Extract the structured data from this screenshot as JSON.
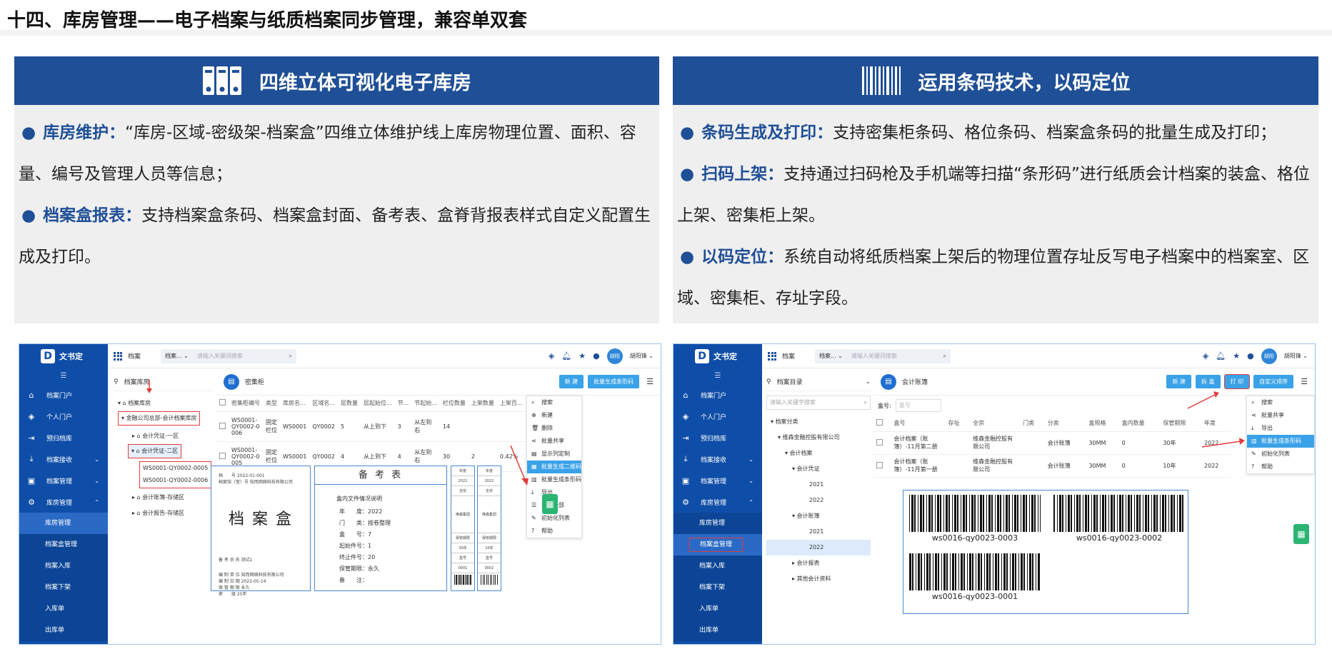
{
  "page": {
    "title": "十四、库房管理——电子档案与纸质档案同步管理，兼容单双套"
  },
  "left_panel": {
    "header": "四维立体可视化电子库房",
    "header_icon": "binders-icon",
    "items": [
      {
        "keyword": "库房维护：",
        "text": "“库房-区域-密级架-档案盒”四维立体维护线上库房物理位置、面积、容量、编号及管理人员等信息；"
      },
      {
        "keyword": "档案盒报表：",
        "text": "支持档案盒条码、档案盒封面、备考表、盒脊背报表样式自定义配置生成及打印。"
      }
    ]
  },
  "right_panel": {
    "header": "运用条码技术，以码定位",
    "header_icon": "barcode-icon",
    "items": [
      {
        "keyword": "条码生成及打印：",
        "text": "支持密集柜条码、格位条码、档案盒条码的批量生成及打印；"
      },
      {
        "keyword": "扫码上架：",
        "text": "支持通过扫码枪及手机端等扫描“条形码”进行纸质会计档案的装盒、格位上架、密集柜上架。"
      },
      {
        "keyword": "以码定位：",
        "text": "系统自动将纸质档案上架后的物理位置存址反写电子档案中的档案室、区域、密集柜、存址字段。"
      }
    ]
  },
  "app": {
    "logo": "文书定",
    "logo_mark": "D",
    "collapse": "☰",
    "top_title": "档案",
    "search_select": "档案... ⌄",
    "search_placeholder": "请输入关键词搜索",
    "avatar": "胡阳",
    "username": "胡阳锋 ⌄",
    "nav": [
      "档案门户",
      "个人门户",
      "预归档库",
      "档案接收",
      "档案管理",
      "库房管理"
    ],
    "nav_sub": [
      "库房管理",
      "档案盒管理",
      "档案入库",
      "档案下架",
      "入库单",
      "出库单"
    ]
  },
  "left_shot": {
    "tree_title": "档案库房",
    "tree": [
      "档案库房",
      "金融公司总部-会计档案库房",
      "会计凭证-一区",
      "会计凭证-二区",
      "WS0001-QY0002-0005",
      "WS0001-QY0002-0006",
      "会计账簿-存储区",
      "会计报告-存储区"
    ],
    "content_title": "密集柜",
    "buttons": [
      "新 建",
      "批量生成条形码"
    ],
    "columns": [
      "密集柜编号",
      "类型",
      "库房名...",
      "区域名...",
      "层数量",
      "层起始位...",
      "节...",
      "节起始...",
      "栏位数量",
      "上架数量",
      "上架百..."
    ],
    "rows": [
      [
        "WS0001-QY0002-0006",
        "固定栏位",
        "WS0001",
        "QY0002",
        "5",
        "从上到下",
        "3",
        "从左到右",
        "14",
        "",
        ""
      ],
      [
        "WS0001-QY0002-0005",
        "固定栏位",
        "WS0001",
        "QY0002",
        "4",
        "从上到下",
        "4",
        "从左到右",
        "30",
        "2",
        "0.42%"
      ]
    ],
    "menu": [
      "搜索",
      "新建",
      "删除",
      "批量共享",
      "显示列定制",
      "批量生成二维码",
      "批量生成条形码",
      "导出",
      "打印全部",
      "初始化列表",
      "帮助"
    ],
    "box_cover": {
      "top_lines": [
        "档　　号 2022-01-001",
        "档案馆（室）号 知而网络科技有限公司"
      ],
      "title": "档 案 盒",
      "bottom_lines": [
        "备 考 员 名  测试1",
        "编 制 单 位  知而网络科技有限公司",
        "编 制 日 期  2022-05-14",
        "保 管 期 限  永久",
        "密　　级  25年"
      ]
    },
    "remarks": {
      "title": "备 考 表",
      "heading": "盒内文件情况说明",
      "fields": [
        [
          "年　　度：",
          "2022"
        ],
        [
          "门　　类：",
          "按卷整理"
        ],
        [
          "盒　　号：",
          "7"
        ],
        [
          "起始件号：",
          "1"
        ],
        [
          "终止件号：",
          "20"
        ],
        [
          "保管期限：",
          "永久"
        ],
        [
          "备　　注：",
          ""
        ]
      ]
    },
    "spine": {
      "col1": [
        "年度",
        "2022",
        "全宗",
        "维森集团",
        "保管期限",
        "30年",
        "盒号",
        "0001"
      ],
      "col2": [
        "年度",
        "2022",
        "全宗",
        "维森集团",
        "保管期限",
        "10年",
        "盒号",
        "0002"
      ]
    }
  },
  "right_shot": {
    "tree_title": "档案目录",
    "tree": [
      "请输入关键字搜索",
      "档案分类",
      "维森金融控股有限公司",
      "会计档案",
      "会计凭证",
      "2021",
      "2022",
      "会计账簿",
      "2021",
      "2022",
      "会计报表",
      "其他会计资料"
    ],
    "content_title": "会计账簿",
    "box_label": "盒号:",
    "box_placeholder": "盒号",
    "buttons": [
      "新 建",
      "拆 盒",
      "打 印",
      "自定义排序"
    ],
    "columns": [
      "盒号",
      "存址",
      "全宗",
      "门类",
      "分类",
      "盒规格",
      "盒内数量",
      "保管期限",
      "年度"
    ],
    "rows": [
      [
        "会计档案（账簿）-11月第二册",
        "",
        "维森金融控股有限公司",
        "",
        "会计账簿",
        "30MM",
        "0",
        "30年",
        "2022"
      ],
      [
        "会计档案（账簿）-11月第一册",
        "",
        "维森金融控股有限公司",
        "",
        "会计账簿",
        "30MM",
        "0",
        "10年",
        "2022"
      ]
    ],
    "menu": [
      "搜索",
      "批量共享",
      "导出",
      "批量生成条形码",
      "初始化列表",
      "帮助"
    ],
    "barcodes": [
      "ws0016-qy0023-0003",
      "ws0016-qy0023-0002",
      "ws0016-qy0023-0001"
    ]
  }
}
